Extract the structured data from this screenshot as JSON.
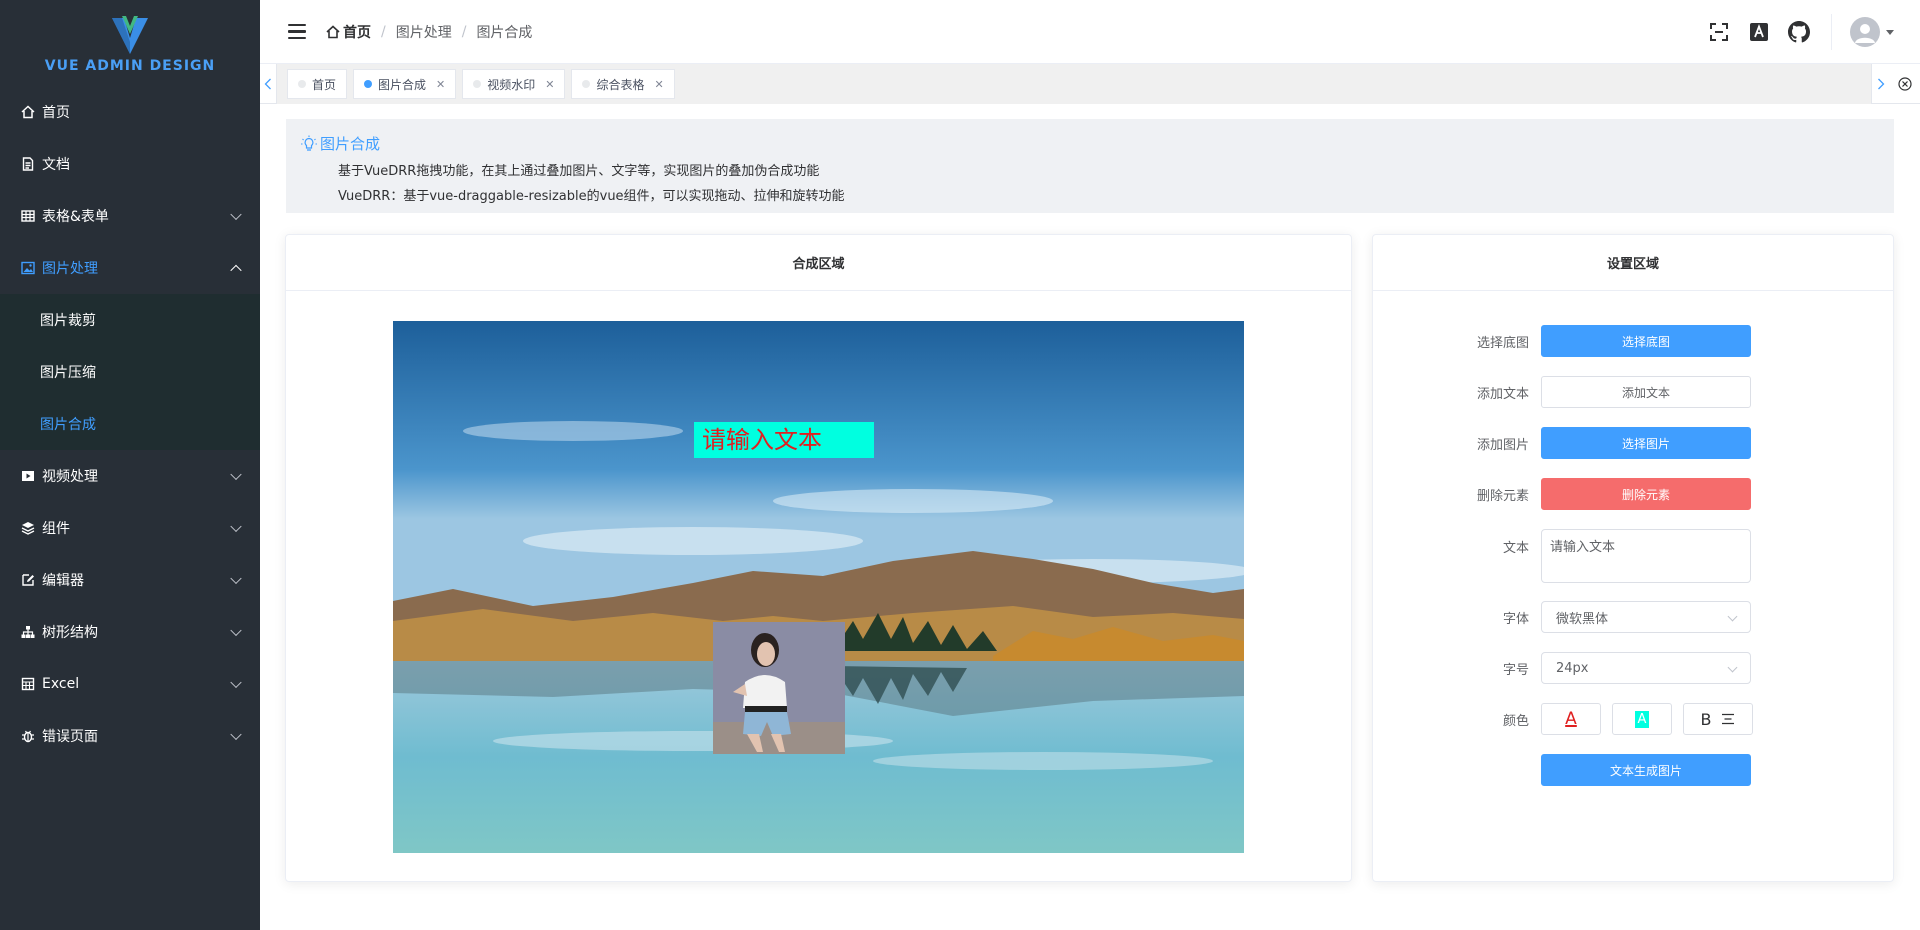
{
  "sidebar": {
    "logo_title": "VUE ADMIN DESIGN",
    "items": [
      {
        "label": "首页",
        "icon": "home-icon"
      },
      {
        "label": "文档",
        "icon": "document-icon"
      },
      {
        "label": "表格&表单",
        "icon": "table-icon"
      },
      {
        "label": "图片处理",
        "icon": "image-icon"
      },
      {
        "label": "视频处理",
        "icon": "video-icon"
      },
      {
        "label": "组件",
        "icon": "layers-icon"
      },
      {
        "label": "编辑器",
        "icon": "edit-icon"
      },
      {
        "label": "树形结构",
        "icon": "tree-icon"
      },
      {
        "label": "Excel",
        "icon": "excel-icon"
      },
      {
        "label": "错误页面",
        "icon": "bug-icon"
      }
    ],
    "image_submenu": [
      "图片裁剪",
      "图片压缩",
      "图片合成"
    ]
  },
  "header": {
    "breadcrumb": [
      "首页",
      "图片处理",
      "图片合成"
    ]
  },
  "tags": [
    {
      "label": "首页",
      "active": false,
      "closable": false
    },
    {
      "label": "图片合成",
      "active": true,
      "closable": true
    },
    {
      "label": "视频水印",
      "active": false,
      "closable": true
    },
    {
      "label": "综合表格",
      "active": false,
      "closable": true
    }
  ],
  "intro": {
    "title": "图片合成",
    "line1": "基于VueDRR拖拽功能，在其上通过叠加图片、文字等，实现图片的叠加伪合成功能",
    "line2": "VueDRR：基于vue-draggable-resizable的vue组件，可以实现拖动、拉伸和旋转功能"
  },
  "compose": {
    "title": "合成区域",
    "overlay_text": "请输入文本"
  },
  "settings": {
    "title": "设置区域",
    "base_label": "选择底图",
    "base_button": "选择底图",
    "add_text_label": "添加文本",
    "add_text_button": "添加文本",
    "add_image_label": "添加图片",
    "add_image_button": "选择图片",
    "delete_label": "删除元素",
    "delete_button": "删除元素",
    "text_label": "文本",
    "text_value": "请输入文本",
    "font_label": "字体",
    "font_value": "微软黑体",
    "size_label": "字号",
    "size_value": "24px",
    "color_label": "颜色",
    "font_color_glyph": "A",
    "bg_color_glyph": "A",
    "bold_glyph": "B",
    "generate_button": "文本生成图片"
  },
  "colors": {
    "accent": "#409eff",
    "danger": "#f56c6c",
    "sidebar_bg": "#282f37",
    "text_overlay_bg": "#00ffe0",
    "text_overlay_fg": "#e02020"
  }
}
